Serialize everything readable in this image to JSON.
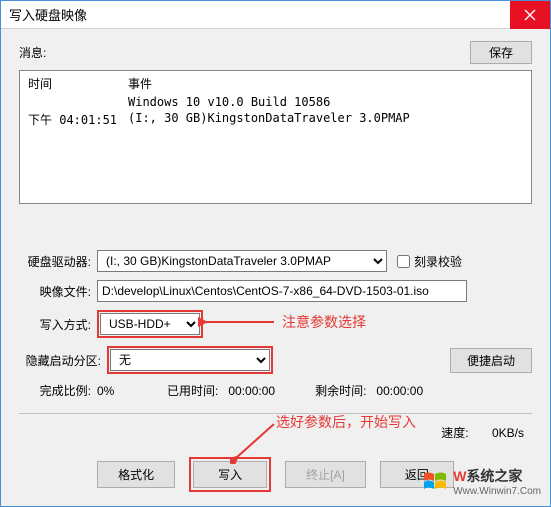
{
  "window": {
    "title": "写入硬盘映像"
  },
  "msg": {
    "label": "消息:",
    "save": "保存"
  },
  "log": {
    "col_time": "时间",
    "col_event": "事件",
    "rows": [
      {
        "time": "",
        "event": "Windows 10 v10.0 Build 10586"
      },
      {
        "time": "下午 04:01:51",
        "event": "(I:, 30 GB)KingstonDataTraveler 3.0PMAP"
      }
    ]
  },
  "form": {
    "drive_label": "硬盘驱动器:",
    "drive_value": "(I:, 30 GB)KingstonDataTraveler 3.0PMAP",
    "verify": "刻录校验",
    "image_label": "映像文件:",
    "image_value": "D:\\develop\\Linux\\Centos\\CentOS-7-x86_64-DVD-1503-01.iso",
    "method_label": "写入方式:",
    "method_value": "USB-HDD+",
    "hide_label": "隐藏启动分区:",
    "hide_value": "无",
    "quick_boot": "便捷启动"
  },
  "progress": {
    "label": "完成比例:",
    "percent": "0%",
    "elapsed_label": "已用时间:",
    "elapsed": "00:00:00",
    "remain_label": "剩余时间:",
    "remain": "00:00:00",
    "speed_label": "速度:",
    "speed": "0KB/s"
  },
  "buttons": {
    "format": "格式化",
    "write": "写入",
    "abort": "终止[A]",
    "back": "返回"
  },
  "anno": {
    "a1": "注意参数选择",
    "a2": "选好参数后，开始写入"
  },
  "logo": {
    "big_prefix": "W",
    "big_rest": "系统之家",
    "small": "Www.Winwin7.Com"
  }
}
